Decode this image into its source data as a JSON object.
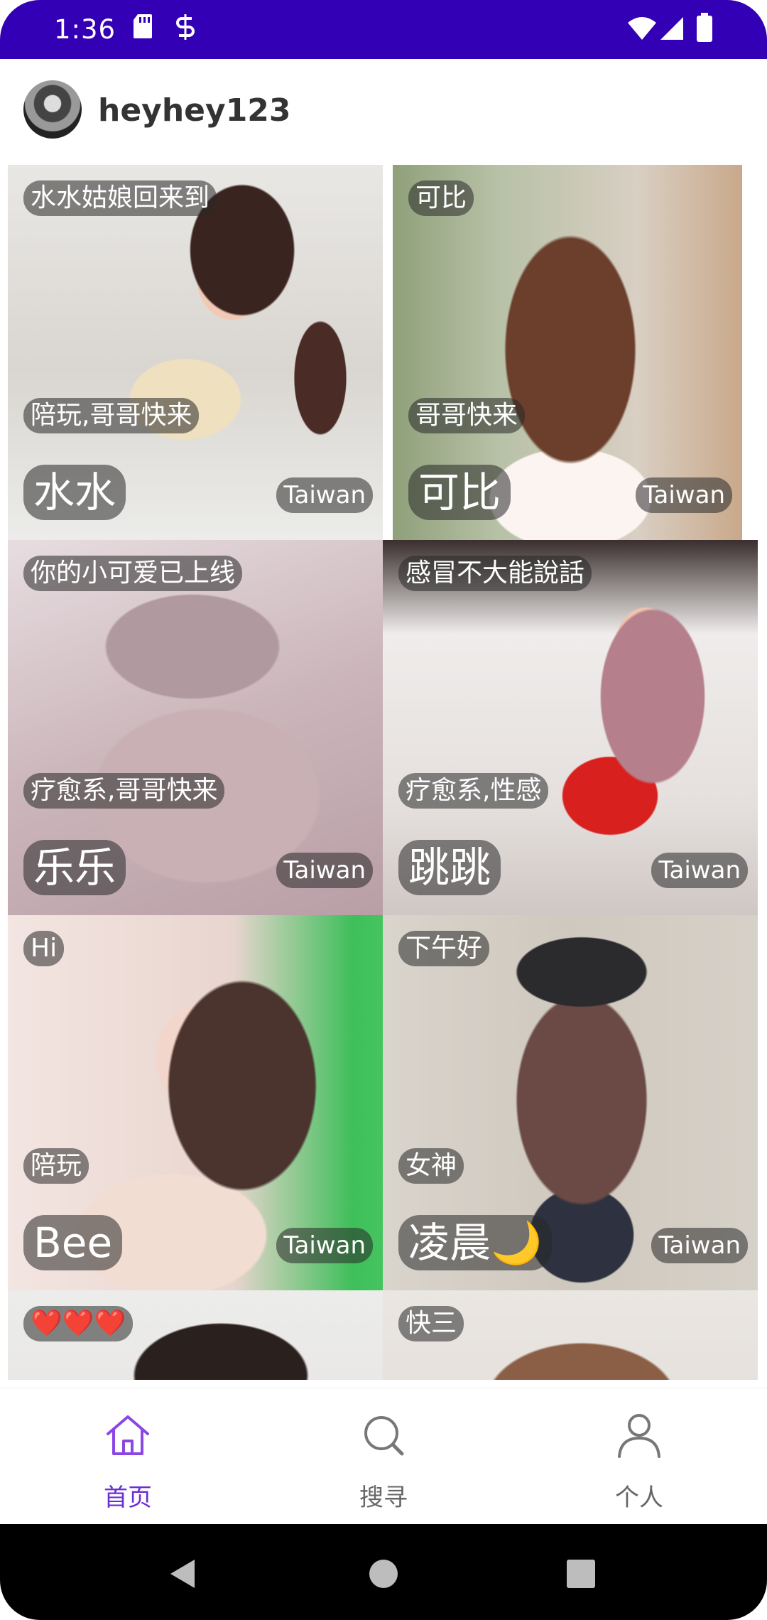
{
  "status_bar": {
    "time": "1:36"
  },
  "header": {
    "username": "heyhey123"
  },
  "cards": [
    {
      "top_tag": "水水姑娘回来到",
      "mid_tag": "陪玩,哥哥快来",
      "name": "水水",
      "country": "Taiwan"
    },
    {
      "top_tag": "可比",
      "mid_tag": "哥哥快来",
      "name": "可比",
      "country": "Taiwan"
    },
    {
      "top_tag": "你的小可爱已上线",
      "mid_tag": "疗愈系,哥哥快来",
      "name": "乐乐",
      "country": "Taiwan"
    },
    {
      "top_tag": "感冒不大能說話",
      "mid_tag": "疗愈系,性感",
      "name": "跳跳",
      "country": "Taiwan"
    },
    {
      "top_tag": "Hi",
      "mid_tag": "陪玩",
      "name": "Bee",
      "country": "Taiwan"
    },
    {
      "top_tag": "下午好",
      "mid_tag": "女神",
      "name": "凌晨🌙",
      "country": "Taiwan"
    },
    {
      "top_tag": "❤️❤️❤️"
    },
    {
      "top_tag": "快三"
    }
  ],
  "bottom_nav": {
    "items": [
      {
        "label": "首页",
        "icon": "home-icon",
        "active": true
      },
      {
        "label": "搜寻",
        "icon": "search-icon",
        "active": false
      },
      {
        "label": "个人",
        "icon": "profile-icon",
        "active": false
      }
    ],
    "active_color": "#6a2fd6",
    "inactive_color": "#666666"
  },
  "colors": {
    "status_bar": "#3400b5"
  }
}
